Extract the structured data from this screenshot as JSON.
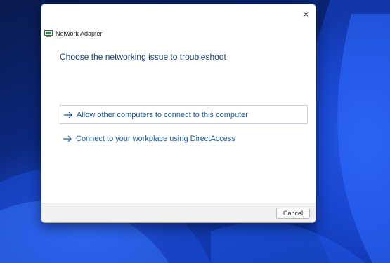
{
  "window": {
    "title": "Network Adapter",
    "icon": "network-adapter-icon"
  },
  "content": {
    "heading": "Choose the networking issue to troubleshoot",
    "options": [
      {
        "label": "Allow other computers to connect to this computer",
        "icon": "arrow-right-icon",
        "selected": true
      },
      {
        "label": "Connect to your workplace using DirectAccess",
        "icon": "arrow-right-icon",
        "selected": false
      }
    ]
  },
  "footer": {
    "cancel_label": "Cancel"
  },
  "colors": {
    "link": "#1a5a96",
    "heading": "#1e3a6e",
    "wallpaper": "#0b2a86"
  }
}
